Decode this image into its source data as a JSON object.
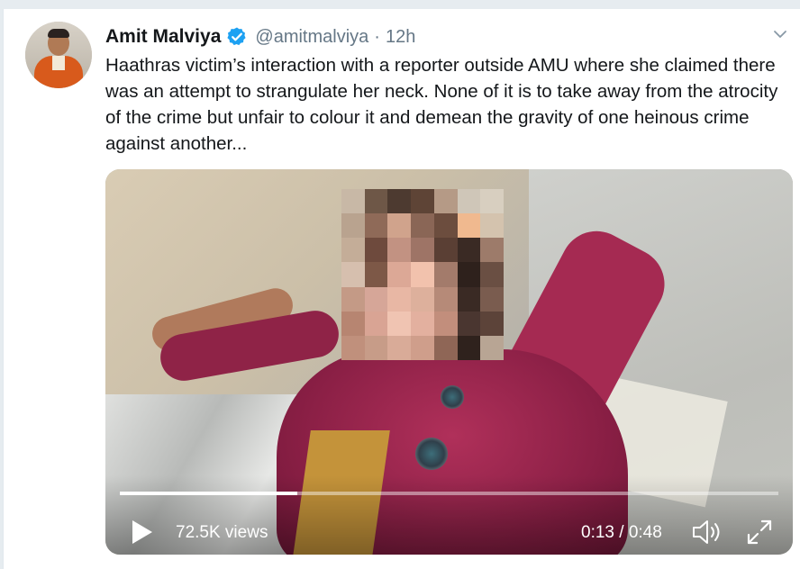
{
  "tweet": {
    "author": {
      "display_name": "Amit Malviya",
      "handle": "@amitmalviya",
      "verified": true
    },
    "separator": "·",
    "time": "12h",
    "text": "Haathras victim’s interaction with a reporter outside AMU where she claimed there was an attempt to strangulate her neck. None of it is to take away from the atrocity of the crime but unfair to colour it and demean the gravity of one heinous crime against another...",
    "menu_icon": "chevron-down-icon"
  },
  "video": {
    "views": "72.5K views",
    "time_readout": "0:13 / 0:48",
    "progress": 0.27,
    "icons": {
      "play": "play-icon",
      "volume": "volume-icon",
      "fullscreen": "fullscreen-icon"
    }
  },
  "colors": {
    "name_text": "#14171a",
    "secondary_text": "#657786",
    "verified_blue": "#1da1f2",
    "page_background": "#e6ecf0"
  }
}
